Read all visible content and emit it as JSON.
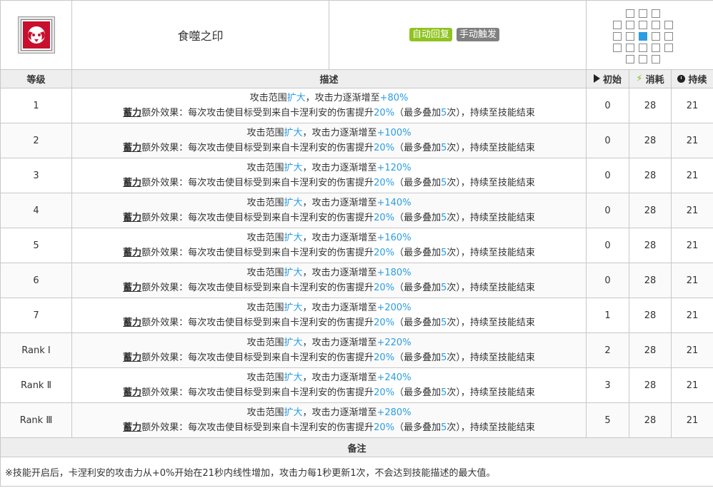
{
  "skill": {
    "name": "食噬之印",
    "tags": [
      "自动回复",
      "手动触发"
    ]
  },
  "range_grid": [
    [
      0,
      1,
      1,
      1,
      0,
      0
    ],
    [
      1,
      1,
      1,
      1,
      1,
      0
    ],
    [
      1,
      1,
      2,
      1,
      1,
      0
    ],
    [
      1,
      1,
      1,
      1,
      1,
      0
    ],
    [
      0,
      1,
      1,
      1,
      0,
      0
    ]
  ],
  "header": {
    "level": "等级",
    "desc": "描述",
    "initial": "初始",
    "cost": "消耗",
    "duration": "持续"
  },
  "desc_parts": {
    "p1": "攻击范围",
    "hl1": "扩大",
    "p2": "，攻击力逐渐增至",
    "bold": "蓄力",
    "p3": "额外效果：每次攻击使目标受到来自卡涅利安的伤害提升",
    "hl2": "20%",
    "p4": "（最多叠加",
    "hl3": "5",
    "p5": "次），持续至技能结束"
  },
  "rows": [
    {
      "level": "1",
      "atk": "+80%",
      "initial": "0",
      "cost": "28",
      "duration": "21"
    },
    {
      "level": "2",
      "atk": "+100%",
      "initial": "0",
      "cost": "28",
      "duration": "21"
    },
    {
      "level": "3",
      "atk": "+120%",
      "initial": "0",
      "cost": "28",
      "duration": "21"
    },
    {
      "level": "4",
      "atk": "+140%",
      "initial": "0",
      "cost": "28",
      "duration": "21"
    },
    {
      "level": "5",
      "atk": "+160%",
      "initial": "0",
      "cost": "28",
      "duration": "21"
    },
    {
      "level": "6",
      "atk": "+180%",
      "initial": "0",
      "cost": "28",
      "duration": "21"
    },
    {
      "level": "7",
      "atk": "+200%",
      "initial": "1",
      "cost": "28",
      "duration": "21"
    },
    {
      "level": "Rank Ⅰ",
      "atk": "+220%",
      "initial": "2",
      "cost": "28",
      "duration": "21"
    },
    {
      "level": "Rank Ⅱ",
      "atk": "+240%",
      "initial": "3",
      "cost": "28",
      "duration": "21"
    },
    {
      "level": "Rank Ⅲ",
      "atk": "+280%",
      "initial": "5",
      "cost": "28",
      "duration": "21"
    }
  ],
  "notes": {
    "title": "备注",
    "text": "※技能开启后，卡涅利安的攻击力从+0%开始在21秒内线性增加，攻击力每1秒更新1次，不会达到技能描述的最大值。"
  },
  "colors": {
    "accent": "#2a9de2",
    "auto_tag": "#8fc31f",
    "manual_tag": "#808080"
  }
}
